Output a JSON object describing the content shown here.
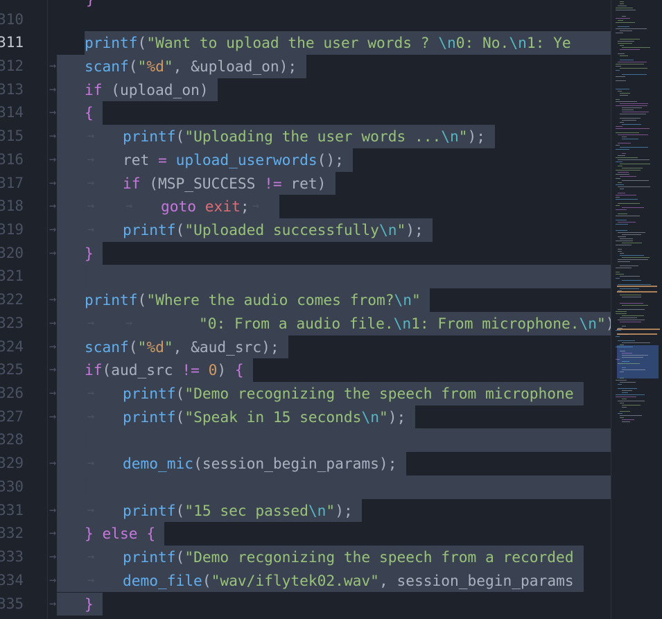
{
  "editor": {
    "active_line": "311",
    "line_numbers": [
      "310",
      "311",
      "312",
      "313",
      "314",
      "315",
      "316",
      "317",
      "318",
      "319",
      "320",
      "321",
      "322",
      "323",
      "324",
      "325",
      "326",
      "327",
      "328",
      "329",
      "330",
      "331",
      "332",
      "333",
      "334",
      "335"
    ],
    "top_partial_text": "}"
  },
  "lines": [
    {
      "num": "310",
      "tokens": []
    },
    {
      "num": "311",
      "tokens": [
        {
          "t": "printf",
          "c": "fn"
        },
        {
          "t": "(",
          "c": "plain"
        },
        {
          "t": "\"Want to upload the user words ? ",
          "c": "str"
        },
        {
          "t": "\\n",
          "c": "esc"
        },
        {
          "t": "0: No.",
          "c": "str"
        },
        {
          "t": "\\n",
          "c": "esc"
        },
        {
          "t": "1: Ye",
          "c": "str"
        }
      ]
    },
    {
      "num": "312",
      "tokens": [
        {
          "t": "scanf",
          "c": "fn"
        },
        {
          "t": "(",
          "c": "plain"
        },
        {
          "t": "\"",
          "c": "str"
        },
        {
          "t": "%d",
          "c": "num"
        },
        {
          "t": "\"",
          "c": "str"
        },
        {
          "t": ", &upload_on);",
          "c": "plain"
        }
      ]
    },
    {
      "num": "313",
      "tokens": [
        {
          "t": "if",
          "c": "kw"
        },
        {
          "t": " (upload_on)",
          "c": "plain"
        }
      ]
    },
    {
      "num": "314",
      "tokens": [
        {
          "t": "{",
          "c": "kw"
        }
      ]
    },
    {
      "num": "315",
      "tokens": [
        {
          "t": "printf",
          "c": "fn"
        },
        {
          "t": "(",
          "c": "plain"
        },
        {
          "t": "\"Uploading the user words ...",
          "c": "str"
        },
        {
          "t": "\\n",
          "c": "esc"
        },
        {
          "t": "\"",
          "c": "str"
        },
        {
          "t": ");",
          "c": "plain"
        }
      ]
    },
    {
      "num": "316",
      "tokens": [
        {
          "t": "ret ",
          "c": "plain"
        },
        {
          "t": "=",
          "c": "kw"
        },
        {
          "t": " ",
          "c": "plain"
        },
        {
          "t": "upload_userwords",
          "c": "fn"
        },
        {
          "t": "();",
          "c": "plain"
        }
      ]
    },
    {
      "num": "317",
      "tokens": [
        {
          "t": "if",
          "c": "kw"
        },
        {
          "t": " (MSP_SUCCESS ",
          "c": "plain"
        },
        {
          "t": "!=",
          "c": "kw"
        },
        {
          "t": " ret)",
          "c": "plain"
        }
      ]
    },
    {
      "num": "318",
      "tokens": [
        {
          "t": "goto",
          "c": "kw"
        },
        {
          "t": " ",
          "c": "plain"
        },
        {
          "t": "exit",
          "c": "var"
        },
        {
          "t": ";",
          "c": "plain"
        }
      ]
    },
    {
      "num": "319",
      "tokens": [
        {
          "t": "printf",
          "c": "fn"
        },
        {
          "t": "(",
          "c": "plain"
        },
        {
          "t": "\"Uploaded successfully",
          "c": "str"
        },
        {
          "t": "\\n",
          "c": "esc"
        },
        {
          "t": "\"",
          "c": "str"
        },
        {
          "t": ");",
          "c": "plain"
        }
      ]
    },
    {
      "num": "320",
      "tokens": [
        {
          "t": "}",
          "c": "kw"
        }
      ]
    },
    {
      "num": "321",
      "tokens": []
    },
    {
      "num": "322",
      "tokens": [
        {
          "t": "printf",
          "c": "fn"
        },
        {
          "t": "(",
          "c": "plain"
        },
        {
          "t": "\"Where the audio comes from?",
          "c": "str"
        },
        {
          "t": "\\n",
          "c": "esc"
        },
        {
          "t": "\"",
          "c": "str"
        }
      ]
    },
    {
      "num": "323",
      "tokens": [
        {
          "t": "\"0: From a audio file.",
          "c": "str"
        },
        {
          "t": "\\n",
          "c": "esc"
        },
        {
          "t": "1: From microphone.",
          "c": "str"
        },
        {
          "t": "\\n",
          "c": "esc"
        },
        {
          "t": "\"",
          "c": "str"
        },
        {
          "t": ")",
          "c": "plain"
        }
      ]
    },
    {
      "num": "324",
      "tokens": [
        {
          "t": "scanf",
          "c": "fn"
        },
        {
          "t": "(",
          "c": "plain"
        },
        {
          "t": "\"",
          "c": "str"
        },
        {
          "t": "%d",
          "c": "num"
        },
        {
          "t": "\"",
          "c": "str"
        },
        {
          "t": ", &aud_src);",
          "c": "plain"
        }
      ]
    },
    {
      "num": "325",
      "tokens": [
        {
          "t": "if",
          "c": "kw"
        },
        {
          "t": "(aud_src ",
          "c": "plain"
        },
        {
          "t": "!=",
          "c": "kw"
        },
        {
          "t": " ",
          "c": "plain"
        },
        {
          "t": "0",
          "c": "num"
        },
        {
          "t": ") ",
          "c": "plain"
        },
        {
          "t": "{",
          "c": "kw"
        }
      ]
    },
    {
      "num": "326",
      "tokens": [
        {
          "t": "printf",
          "c": "fn"
        },
        {
          "t": "(",
          "c": "plain"
        },
        {
          "t": "\"Demo recognizing the speech from microphone",
          "c": "str"
        }
      ]
    },
    {
      "num": "327",
      "tokens": [
        {
          "t": "printf",
          "c": "fn"
        },
        {
          "t": "(",
          "c": "plain"
        },
        {
          "t": "\"Speak in 15 seconds",
          "c": "str"
        },
        {
          "t": "\\n",
          "c": "esc"
        },
        {
          "t": "\"",
          "c": "str"
        },
        {
          "t": ");",
          "c": "plain"
        }
      ]
    },
    {
      "num": "328",
      "tokens": []
    },
    {
      "num": "329",
      "tokens": [
        {
          "t": "demo_mic",
          "c": "fn"
        },
        {
          "t": "(session_begin_params);",
          "c": "plain"
        }
      ]
    },
    {
      "num": "330",
      "tokens": []
    },
    {
      "num": "331",
      "tokens": [
        {
          "t": "printf",
          "c": "fn"
        },
        {
          "t": "(",
          "c": "plain"
        },
        {
          "t": "\"15 sec passed",
          "c": "str"
        },
        {
          "t": "\\n",
          "c": "esc"
        },
        {
          "t": "\"",
          "c": "str"
        },
        {
          "t": ");",
          "c": "plain"
        }
      ]
    },
    {
      "num": "332",
      "tokens": [
        {
          "t": "}",
          "c": "kw"
        },
        {
          "t": " ",
          "c": "plain"
        },
        {
          "t": "else",
          "c": "kw"
        },
        {
          "t": " ",
          "c": "plain"
        },
        {
          "t": "{",
          "c": "kw"
        }
      ]
    },
    {
      "num": "333",
      "tokens": [
        {
          "t": "printf",
          "c": "fn"
        },
        {
          "t": "(",
          "c": "plain"
        },
        {
          "t": "\"Demo recgonizing the speech from a recorded",
          "c": "str"
        }
      ]
    },
    {
      "num": "334",
      "tokens": [
        {
          "t": "demo_file",
          "c": "fn"
        },
        {
          "t": "(",
          "c": "plain"
        },
        {
          "t": "\"wav/iflytek02.wav\"",
          "c": "str"
        },
        {
          "t": ", session_begin_params",
          "c": "plain"
        }
      ]
    },
    {
      "num": "335",
      "tokens": [
        {
          "t": "}",
          "c": "kw"
        }
      ]
    }
  ],
  "colors": {
    "background": "#1e222a",
    "selection": "#3a4150",
    "keyword": "#c678dd",
    "function": "#61afef",
    "string": "#98c379",
    "number": "#d19a66",
    "escape": "#56b6c2",
    "variable": "#e06c75",
    "cursor": "#528bff"
  }
}
